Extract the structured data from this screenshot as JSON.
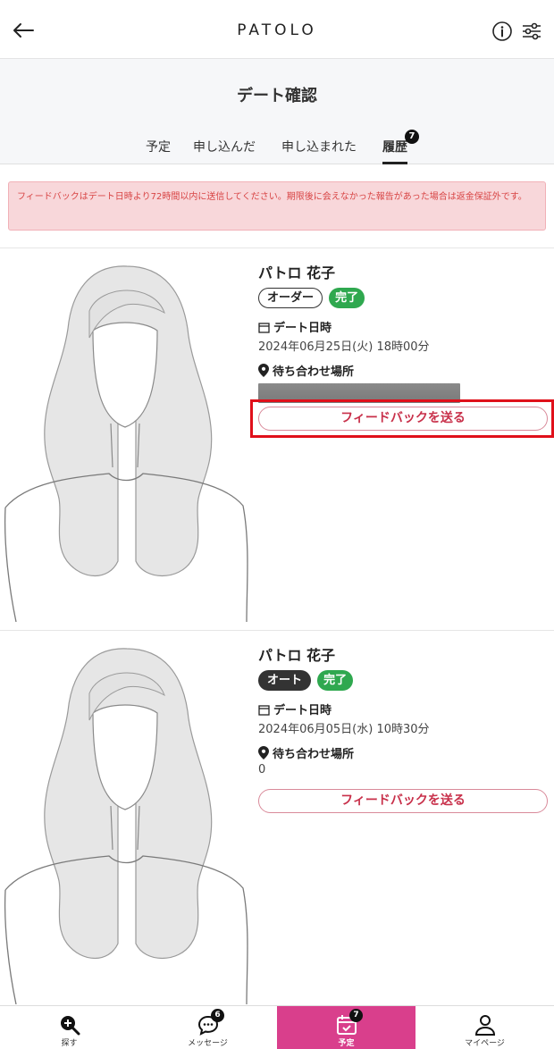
{
  "header": {
    "logo": "PATOLO",
    "back_icon": "arrow-left-icon",
    "info_icon": "info-circle-icon",
    "filter_icon": "sliders-icon"
  },
  "page": {
    "title": "デート確認"
  },
  "tabs": [
    {
      "label": "予定",
      "active": false
    },
    {
      "label": "申し込んだ",
      "active": false
    },
    {
      "label": "申し込まれた",
      "active": false
    },
    {
      "label": "履歴",
      "active": true,
      "badge": "7"
    }
  ],
  "notice": {
    "text": "フィードバックはデート日時より72時間以内に送信してください。期限後に会えなかった報告があった場合は返金保証外です。"
  },
  "cards": [
    {
      "name": "パトロ 花子",
      "type_tag": "オーダー",
      "status_tag": "完了",
      "date_label": "デート日時",
      "date_value": "2024年06月25日(火) 18時00分",
      "place_label": "待ち合わせ場所",
      "place_value": "",
      "place_redacted": true,
      "feedback_label": "フィードバックを送る"
    },
    {
      "name": "パトロ 花子",
      "type_tag": "オート",
      "status_tag": "完了",
      "date_label": "デート日時",
      "date_value": "2024年06月05日(水) 10時30分",
      "place_label": "待ち合わせ場所",
      "place_value": "0",
      "place_redacted": false,
      "feedback_label": "フィードバックを送る"
    }
  ],
  "bottom_nav": [
    {
      "label": "探す",
      "icon": "search-plus-icon",
      "active": false
    },
    {
      "label": "メッセージ",
      "icon": "chat-bubble-icon",
      "badge": "6",
      "active": false
    },
    {
      "label": "予定",
      "icon": "calendar-check-icon",
      "badge": "7",
      "active": true
    },
    {
      "label": "マイページ",
      "icon": "user-icon",
      "active": false
    }
  ],
  "colors": {
    "accent": "#d93f8c",
    "notice_bg": "#f8d7da",
    "notice_text": "#d84545",
    "status_green": "#2fa84f",
    "feedback_text": "#c8304a"
  }
}
